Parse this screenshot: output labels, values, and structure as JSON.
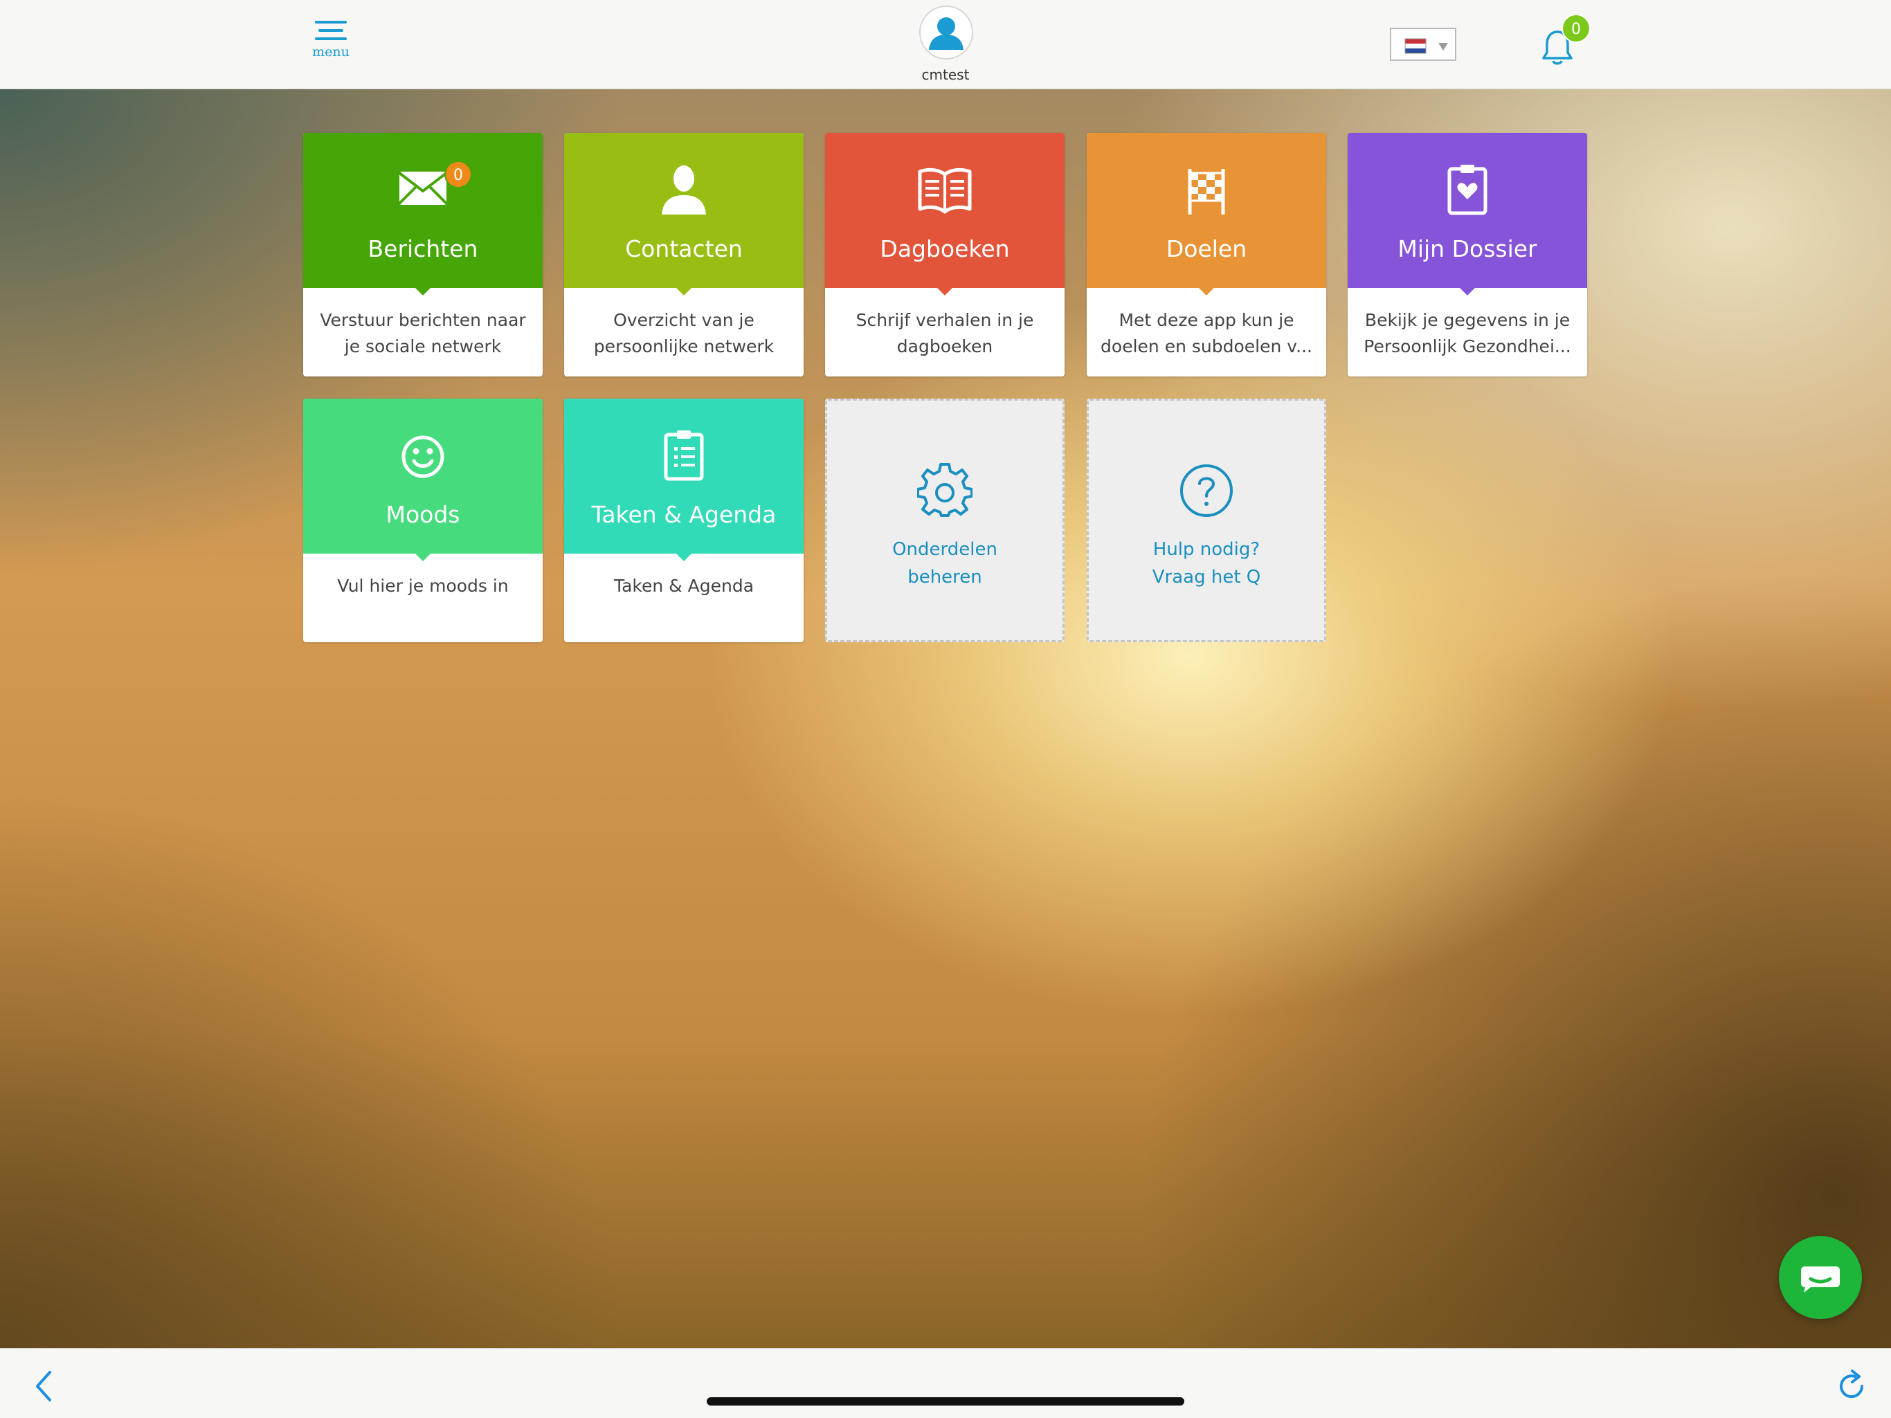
{
  "header": {
    "menu_label": "menu",
    "username": "cmtest",
    "notifications_count": "0"
  },
  "tiles": [
    {
      "title": "Berichten",
      "description": "Verstuur berichten naar je sociale netwerk",
      "color": "#46a607",
      "badge": "0",
      "icon": "envelope-icon"
    },
    {
      "title": "Contacten",
      "description": "Overzicht van je persoonlijke netwerk",
      "color": "#98be14",
      "icon": "person-icon"
    },
    {
      "title": "Dagboeken",
      "description": "Schrijf verhalen in je dagboeken",
      "color": "#e3553a",
      "icon": "book-icon"
    },
    {
      "title": "Doelen",
      "description": "Met deze app kun je doelen en subdoelen v...",
      "color": "#e89436",
      "icon": "checkered-flag-icon"
    },
    {
      "title": "Mijn Dossier",
      "description": "Bekijk je gegevens in je Persoonlijk Gezondhei...",
      "color": "#8654d8",
      "icon": "clipboard-heart-icon"
    },
    {
      "title": "Moods",
      "description": "Vul hier je moods in",
      "color": "#46dc7e",
      "icon": "smiley-icon"
    },
    {
      "title": "Taken & Agenda",
      "description": "Taken & Agenda",
      "color": "#32dbb7",
      "icon": "clipboard-list-icon"
    }
  ],
  "manage_tile": {
    "line1": "Onderdelen",
    "line2": "beheren",
    "icon": "gear-icon"
  },
  "help_tile": {
    "line1": "Hulp nodig?",
    "line2": "Vraag het Q",
    "icon": "question-icon"
  },
  "colors": {
    "accent": "#1a9bd1",
    "chat": "#1eb63a"
  }
}
